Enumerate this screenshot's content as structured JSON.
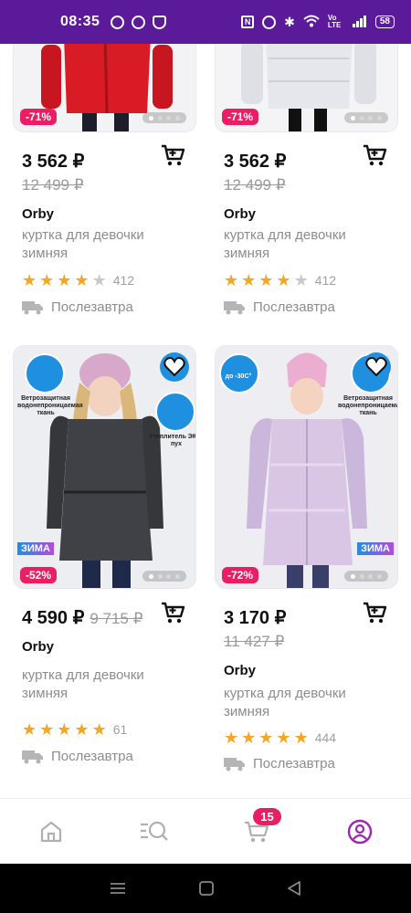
{
  "status_bar": {
    "time": "08:35",
    "battery": "58",
    "network": "Vo LTE"
  },
  "products": [
    {
      "discount": "-71%",
      "price": "3 562 ₽",
      "old_price": "12 499 ₽",
      "brand": "Orby",
      "title": "куртка для девочки зимняя",
      "rating": 4,
      "reviews": "412",
      "delivery": "Послезавтра",
      "color": "red"
    },
    {
      "discount": "-71%",
      "price": "3 562 ₽",
      "old_price": "12 499 ₽",
      "brand": "Orby",
      "title": "куртка для девочки зимняя",
      "rating": 4,
      "reviews": "412",
      "delivery": "Послезавтра",
      "color": "white"
    },
    {
      "discount": "-52%",
      "price": "4 590 ₽",
      "old_price": "9 715 ₽",
      "brand": "Orby",
      "title": "куртка для девочки зимняя",
      "rating": 5,
      "reviews": "61",
      "delivery": "Послезавтра",
      "features": [
        "Ветрозащитная водонепроницаемая ткань",
        "Утеплитель ЭКО-пух"
      ],
      "season_label": "ЗИМА",
      "color": "dark-grey"
    },
    {
      "discount": "-72%",
      "price": "3 170 ₽",
      "old_price": "11 427 ₽",
      "brand": "Orby",
      "title": "куртка для девочки зимняя",
      "rating": 5,
      "reviews": "444",
      "delivery": "Послезавтра",
      "features": [
        "до -30С°",
        "Ветрозащитная водонепроницаемая ткань"
      ],
      "season_label": "ЗИМА",
      "color": "lilac"
    }
  ],
  "bottom_nav": {
    "items": [
      "home-icon",
      "catalog-search-icon",
      "cart-icon",
      "profile-icon"
    ],
    "cart_count": "15",
    "active_color": "#9c27b0"
  },
  "colors": {
    "status_bar": "#5b1a9a",
    "discount": "#e91e63",
    "star": "#f5a623"
  }
}
